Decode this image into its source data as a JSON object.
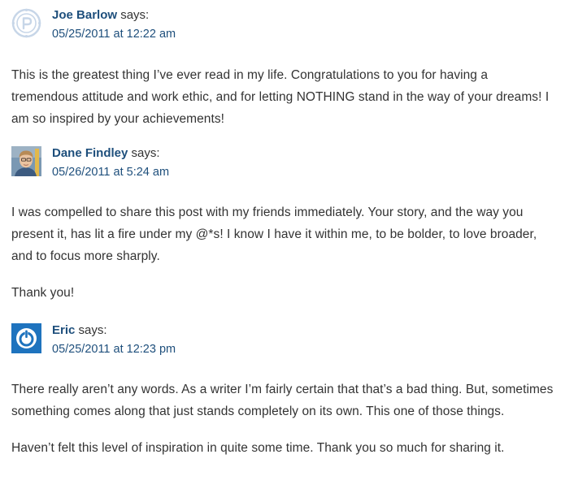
{
  "comments": [
    {
      "author": "Joe Barlow",
      "says": "says:",
      "date": "05/25/2011 at 12:22 am",
      "avatar": "circular-logo-avatar",
      "paragraphs": [
        "This is the greatest thing I’ve ever read in my life. Congratulations to you for having a tremendous attitude and work ethic, and for letting NOTHING stand in the way of your dreams! I am so inspired by your achievements!"
      ]
    },
    {
      "author": "Dane Findley",
      "says": "says:",
      "date": "05/26/2011 at 5:24 am",
      "avatar": "photo-avatar",
      "paragraphs": [
        "I was compelled to share this post with my friends immediately. Your story, and the way you present it, has lit a fire under my @*s! I know I have it within me, to be bolder, to love broader, and to focus more sharply.",
        "Thank you!"
      ]
    },
    {
      "author": "Eric",
      "says": "says:",
      "date": "05/25/2011 at 12:23 pm",
      "avatar": "power-button-avatar",
      "paragraphs": [
        "There really aren’t any words. As a writer I’m fairly certain that that’s a bad thing. But, sometimes something comes along that just stands completely on its own. This one of those things.",
        "Haven’t felt this level of inspiration in quite some time. Thank you so much for sharing it."
      ]
    }
  ],
  "colors": {
    "link": "#1e4f7c",
    "text": "#333333",
    "avatar_blue": "#1e73be"
  }
}
